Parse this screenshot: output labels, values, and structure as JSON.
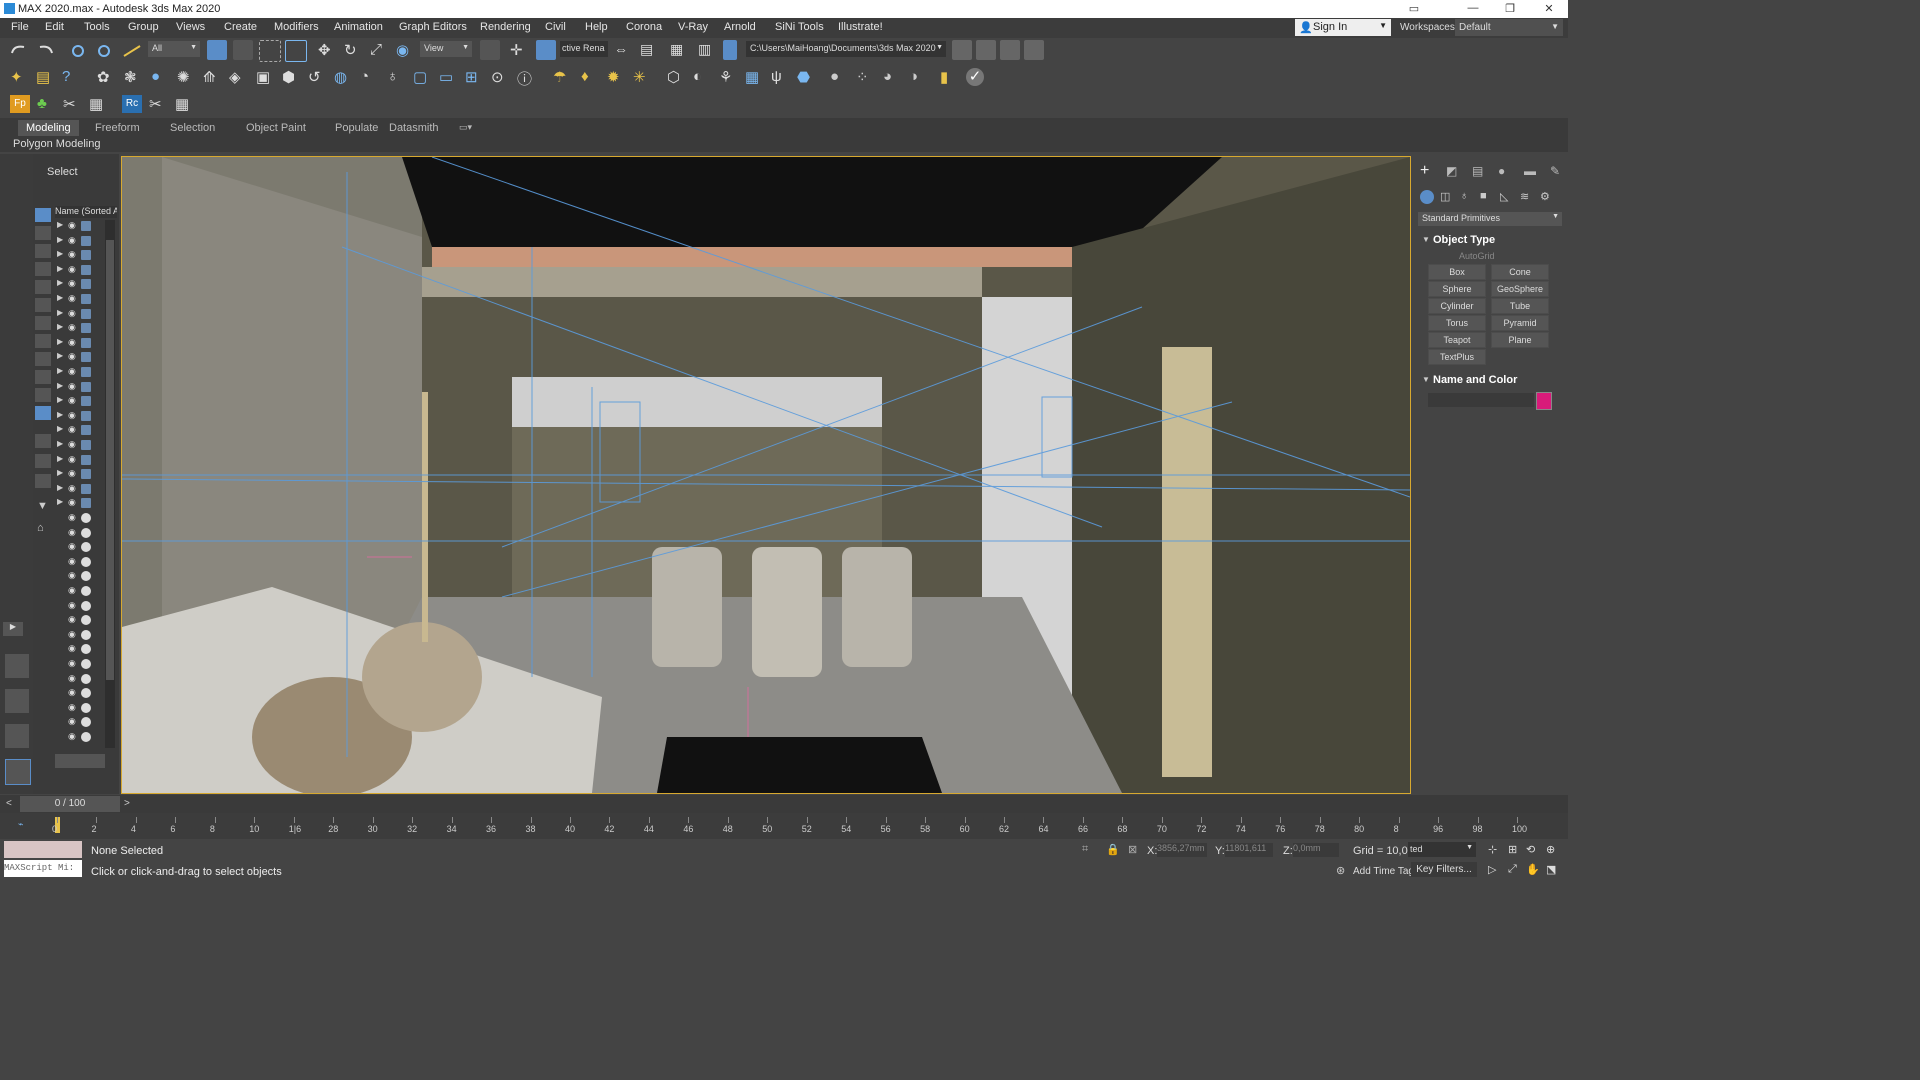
{
  "window": {
    "title": "MAX 2020.max - Autodesk 3ds Max 2020",
    "controls": [
      "—",
      "❐",
      "✕"
    ]
  },
  "menu": [
    "File",
    "Edit",
    "Tools",
    "Group",
    "Views",
    "Create",
    "Modifiers",
    "Animation",
    "Graph Editors",
    "Rendering",
    "Civil",
    "Help",
    "Corona",
    "V-Ray",
    "Arnold",
    "SiNi Tools",
    "Illustrate!"
  ],
  "account": {
    "sign_in": "Sign In",
    "workspaces_label": "Workspaces:",
    "workspace": "Default"
  },
  "toolbar": {
    "selection_filter": "All",
    "ref_coord": "View",
    "render_preset": "ctive Rena",
    "project_path": "C:\\Users\\MaiHoang\\Documents\\3ds Max 2020"
  },
  "ribbon": {
    "tabs": [
      "Modeling",
      "Freeform",
      "Selection",
      "Object Paint",
      "Populate",
      "Datasmith"
    ],
    "active": "Modeling",
    "sub": "Polygon Modeling"
  },
  "explorer": {
    "header": "Select",
    "column": "Name (Sorted A"
  },
  "cmdpanel": {
    "category": "Standard Primitives",
    "object_type_title": "Object Type",
    "autogrid": "AutoGrid",
    "buttons": [
      "Box",
      "Cone",
      "Sphere",
      "GeoSphere",
      "Cylinder",
      "Tube",
      "Torus",
      "Pyramid",
      "Teapot",
      "Plane",
      "TextPlus"
    ],
    "name_color_title": "Name and Color",
    "swatch_color": "#d81b7a"
  },
  "timeline": {
    "frame": "0 / 100",
    "ticks": [
      "0",
      "2",
      "4",
      "6",
      "8",
      "10",
      "1|6",
      "28",
      "30",
      "32",
      "34",
      "36",
      "38",
      "40",
      "42",
      "44",
      "46",
      "48",
      "50",
      "52",
      "54",
      "56",
      "58",
      "60",
      "62",
      "64",
      "66",
      "68",
      "70",
      "72",
      "74",
      "76",
      "78",
      "80",
      "8",
      "96",
      "98",
      "100"
    ]
  },
  "status": {
    "maxscript": "MAXScript Mi:",
    "selection": "None Selected",
    "prompt": "Click or click-and-drag to select objects",
    "x_label": "X:",
    "x_value": "3856,27mm",
    "y_label": "Y:",
    "y_value": "11801,611",
    "z_label": "Z:",
    "z_value": "0,0mm",
    "grid": "Grid = 10,0mm",
    "keymode": "ted",
    "add_time_tag": "Add Time Tag",
    "key_filters": "Key Filters..."
  }
}
